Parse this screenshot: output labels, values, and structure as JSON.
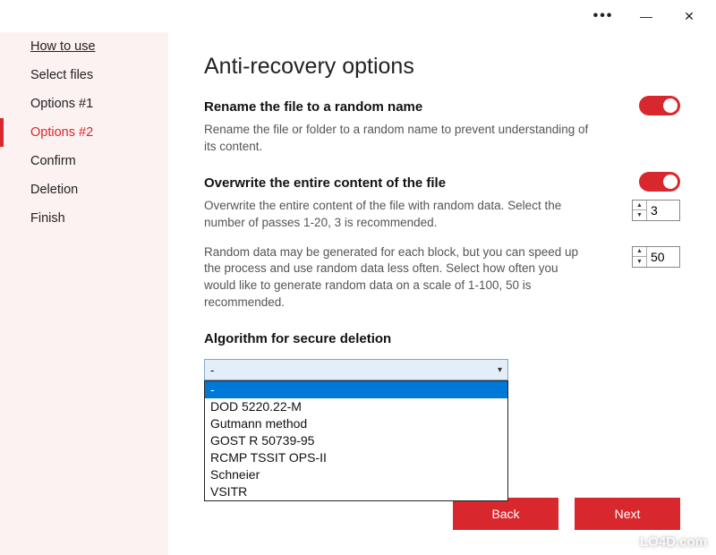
{
  "titlebar": {
    "more": "•••",
    "minimize": "—",
    "close": "✕"
  },
  "sidebar": {
    "items": [
      {
        "label": "How to use",
        "key": "howto"
      },
      {
        "label": "Select files",
        "key": "select"
      },
      {
        "label": "Options #1",
        "key": "opt1"
      },
      {
        "label": "Options #2",
        "key": "opt2"
      },
      {
        "label": "Confirm",
        "key": "confirm"
      },
      {
        "label": "Deletion",
        "key": "deletion"
      },
      {
        "label": "Finish",
        "key": "finish"
      }
    ],
    "active": "opt2"
  },
  "main": {
    "title": "Anti-recovery options",
    "rename": {
      "heading": "Rename the file to a random name",
      "desc": "Rename the file or folder to a random name to prevent understanding of its content.",
      "enabled": true
    },
    "overwrite": {
      "heading": "Overwrite the entire content of the file",
      "desc": "Overwrite the entire content of the file with random data. Select the number of passes 1-20, 3 is recommended.",
      "passes": "3",
      "enabled": true
    },
    "randomdata": {
      "desc": "Random data may be generated for each block, but you can speed up the process and use random data less often. Select how often you would like to generate random data on a scale of 1-100, 50 is recommended.",
      "value": "50"
    },
    "algorithm": {
      "heading": "Algorithm for secure deletion",
      "selected": "-",
      "options": [
        "-",
        "DOD 5220.22-M",
        "Gutmann method",
        "GOST R 50739-95",
        "RCMP TSSIT OPS-II",
        "Schneier",
        "VSITR"
      ]
    },
    "buttons": {
      "back": "Back",
      "next": "Next"
    }
  },
  "watermark": "LO4D.com"
}
